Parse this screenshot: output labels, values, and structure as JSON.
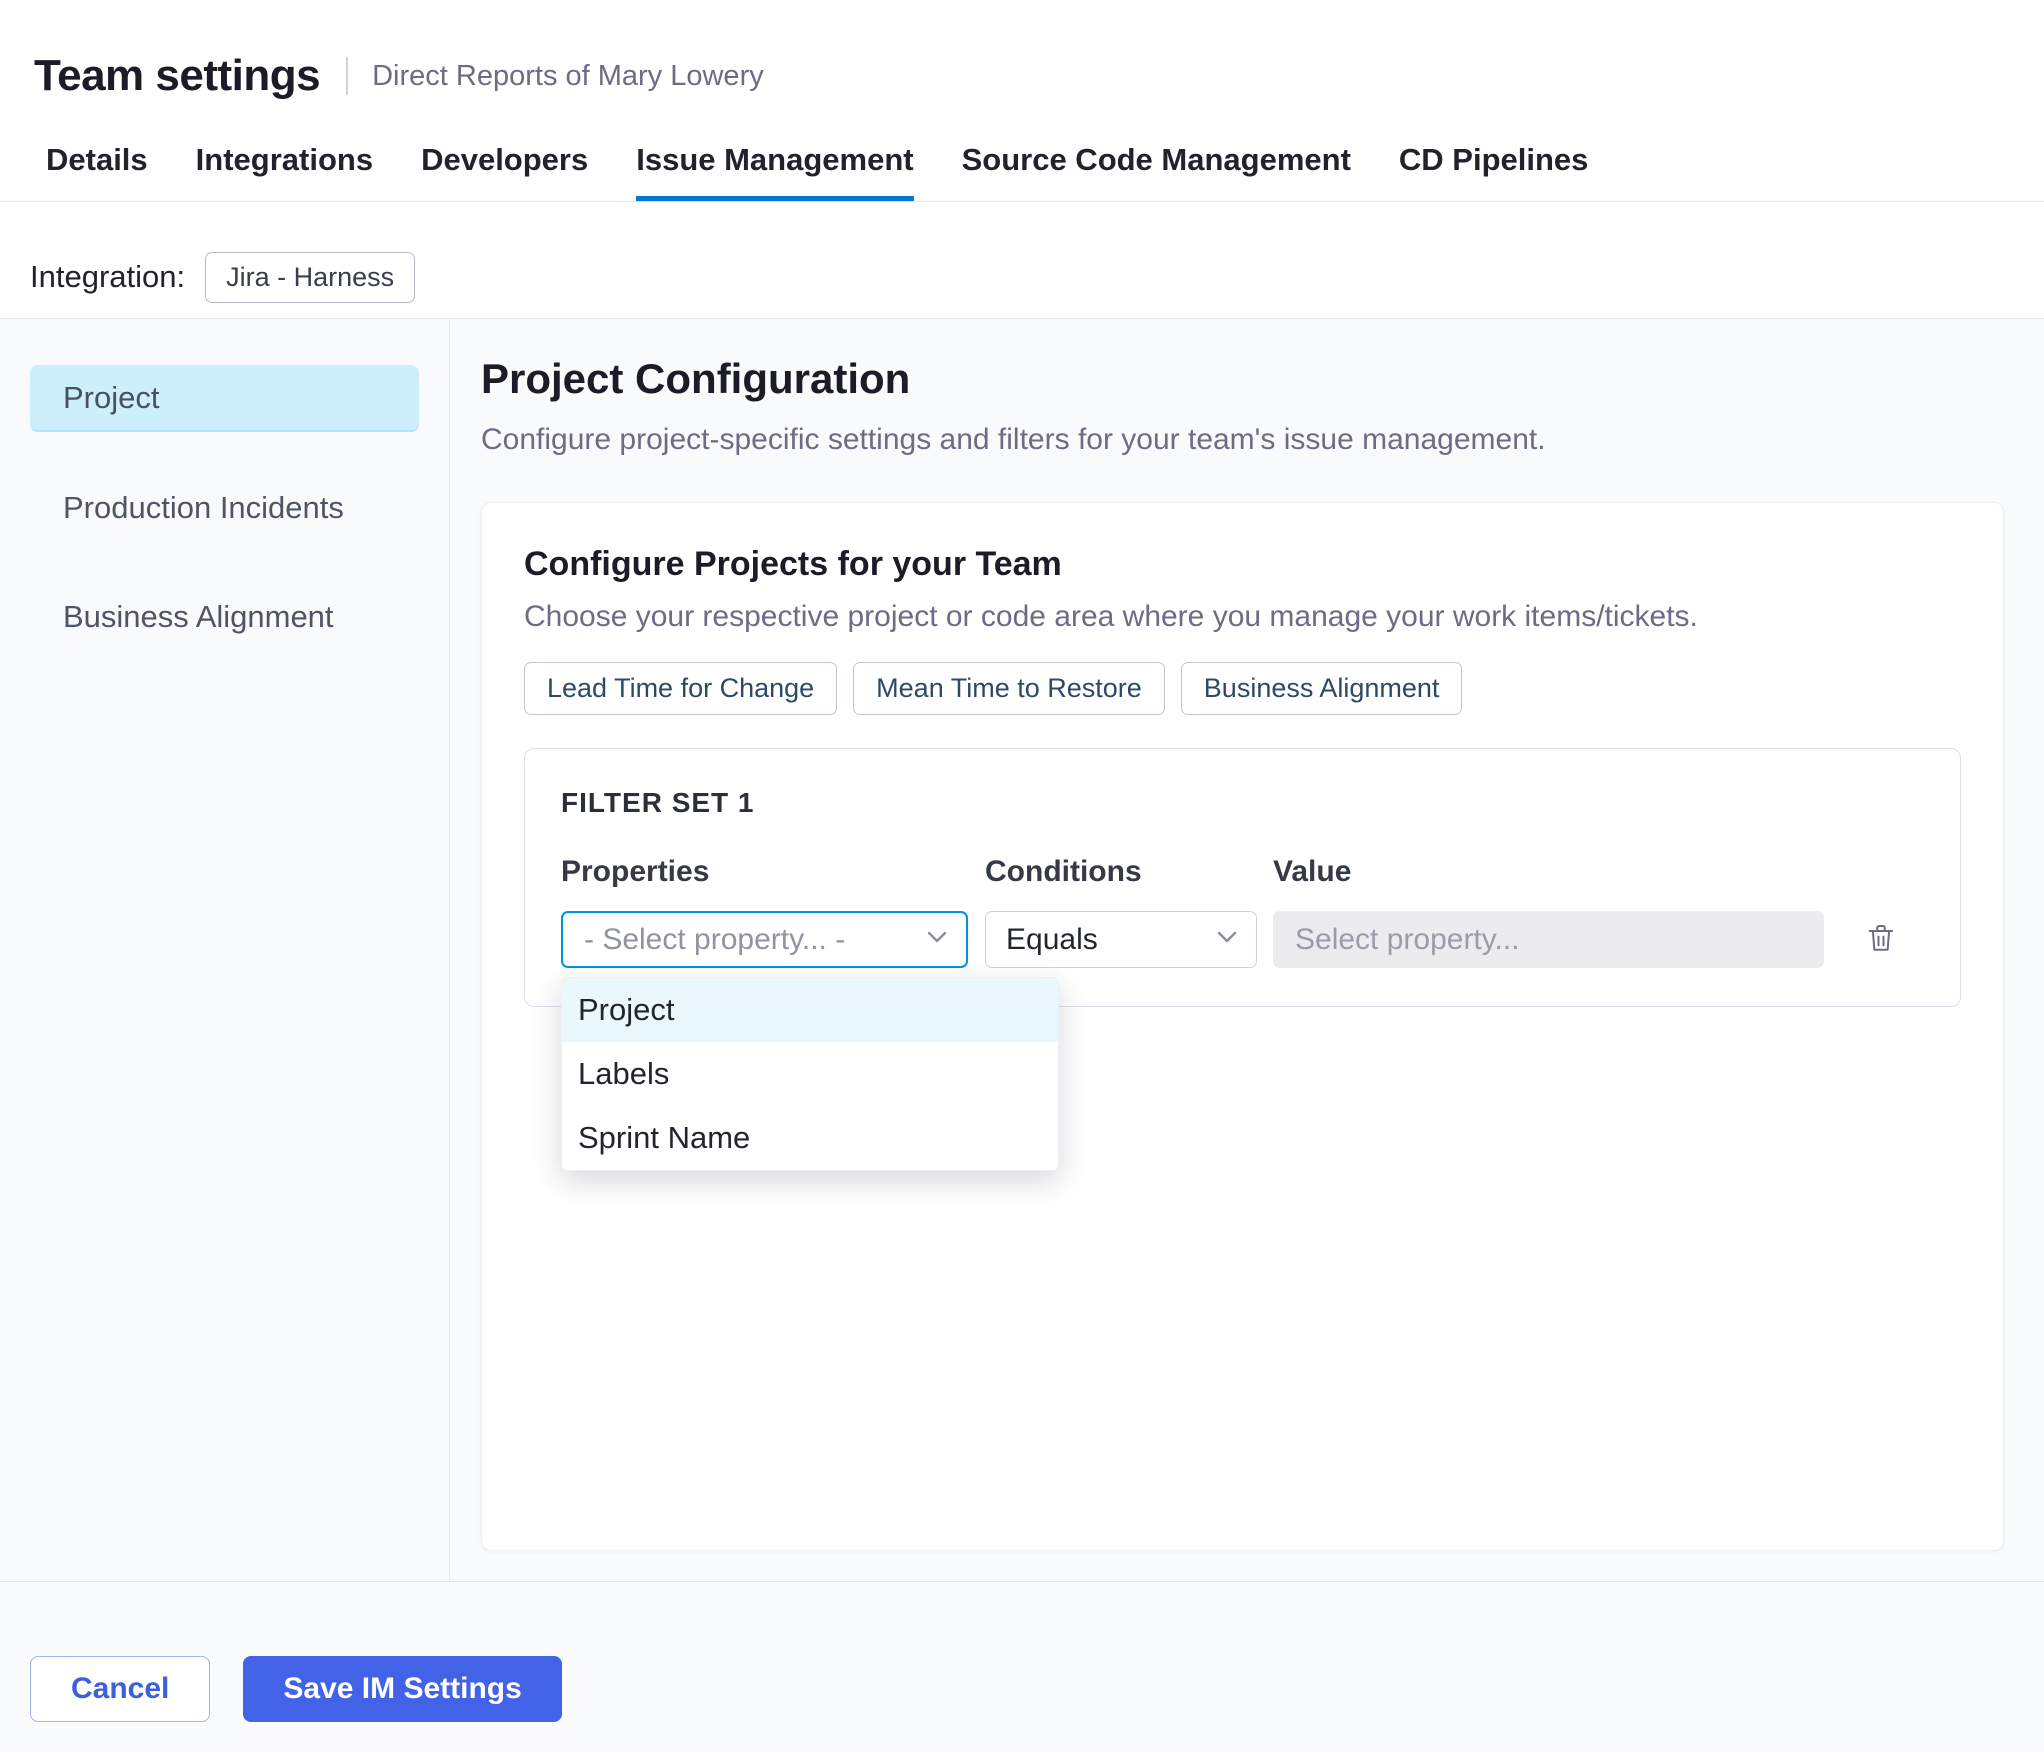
{
  "colors": {
    "tab_underline_accent": "#0278d5",
    "primary_button_bg": "#4263e7",
    "cancel_button_text": "#3b5fe0",
    "selected_nav_bg": "#cdeffc",
    "focused_select_border": "#0092e4",
    "dropdown_highlight_bg": "#eaf8fe",
    "disabled_input_bg": "#ececef"
  },
  "header": {
    "title": "Team settings",
    "subtitle": "Direct Reports of Mary Lowery"
  },
  "tabs": [
    {
      "label": "Details"
    },
    {
      "label": "Integrations"
    },
    {
      "label": "Developers"
    },
    {
      "label": "Issue Management"
    },
    {
      "label": "Source Code Management"
    },
    {
      "label": "CD Pipelines"
    }
  ],
  "active_tab": "Issue Management",
  "integration": {
    "label": "Integration:",
    "value": "Jira - Harness"
  },
  "sidebar": {
    "items": [
      {
        "label": "Project"
      },
      {
        "label": "Production Incidents"
      },
      {
        "label": "Business Alignment"
      }
    ],
    "active_item": "Project"
  },
  "main": {
    "title": "Project Configuration",
    "subtitle": "Configure project-specific settings and filters for your team's issue management.",
    "card": {
      "title": "Configure Projects for your Team",
      "subtitle": "Choose your respective project or code area where you manage your work items/tickets.",
      "chips": [
        "Lead Time for Change",
        "Mean Time to Restore",
        "Business Alignment"
      ],
      "filter_set": {
        "title": "FILTER SET 1",
        "columns": {
          "properties": "Properties",
          "conditions": "Conditions",
          "value": "Value"
        },
        "property_select_value": "- Select property... -",
        "condition_select_value": "Equals",
        "value_input_placeholder": "Select property...",
        "dropdown_options": [
          "Project",
          "Labels",
          "Sprint Name"
        ],
        "dropdown_highlighted": "Project"
      }
    }
  },
  "footer": {
    "cancel_label": "Cancel",
    "save_label": "Save IM Settings"
  }
}
